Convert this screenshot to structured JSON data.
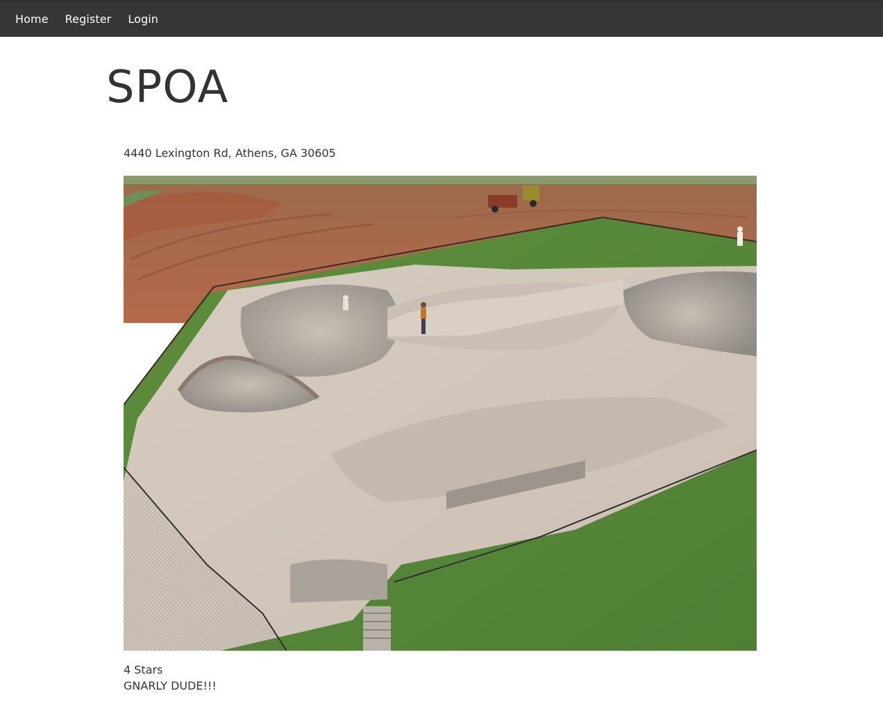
{
  "nav": {
    "items": [
      {
        "label": "Home"
      },
      {
        "label": "Register"
      },
      {
        "label": "Login"
      }
    ],
    "background": "#363636",
    "text_color": "#ffffff"
  },
  "park": {
    "name": "SPOA",
    "address": "4440 Lexington Rd, Athens, GA 30605",
    "rating": "4 Stars",
    "review": "GNARLY DUDE!!!"
  },
  "colors": {
    "text": "#333333",
    "concrete": "#cfc4b8",
    "grass": "#5f8a3e",
    "dirt": "#b0623f"
  }
}
